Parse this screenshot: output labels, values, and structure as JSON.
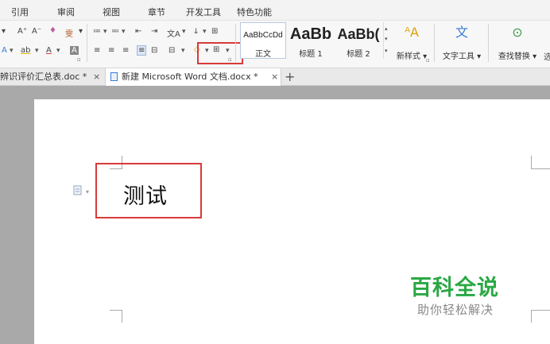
{
  "menu": [
    "引用",
    "审阅",
    "视图",
    "章节",
    "开发工具",
    "特色功能"
  ],
  "ribbon": {
    "font_tools_row1": [
      "A⁺",
      "A⁻",
      "♦",
      "雯"
    ],
    "font_tools_row2": [
      "A",
      "ab",
      "A",
      "A"
    ],
    "para_tools_row1": [
      "≔",
      "≕",
      "⇤",
      "⇥",
      "文A",
      "ↆ",
      "⊞"
    ],
    "para_tools_row2": [
      "≡",
      "≡",
      "≡",
      "≡",
      "⊟",
      "⊟",
      "◇",
      "⊞"
    ],
    "styles": [
      {
        "sample": "AaBbCcDd",
        "label": "正文"
      },
      {
        "sample": "AaBb",
        "label": "标题 1"
      },
      {
        "sample": "AaBb(",
        "label": "标题 2"
      }
    ],
    "new_style": "新样式",
    "text_tools": "文字工具",
    "find_replace": "查找替换",
    "more": "选"
  },
  "tabs": [
    {
      "title": "辨识评价汇总表.doc *"
    },
    {
      "title": "新建 Microsoft Word 文档.docx *"
    }
  ],
  "tab_close": "×",
  "tab_add": "+",
  "document": {
    "text": "测试"
  },
  "watermark": {
    "title": "百科全说",
    "subtitle": "助你轻松解决"
  },
  "colors": {
    "highlight": "#d83a3a",
    "accent": "#2aa845"
  }
}
